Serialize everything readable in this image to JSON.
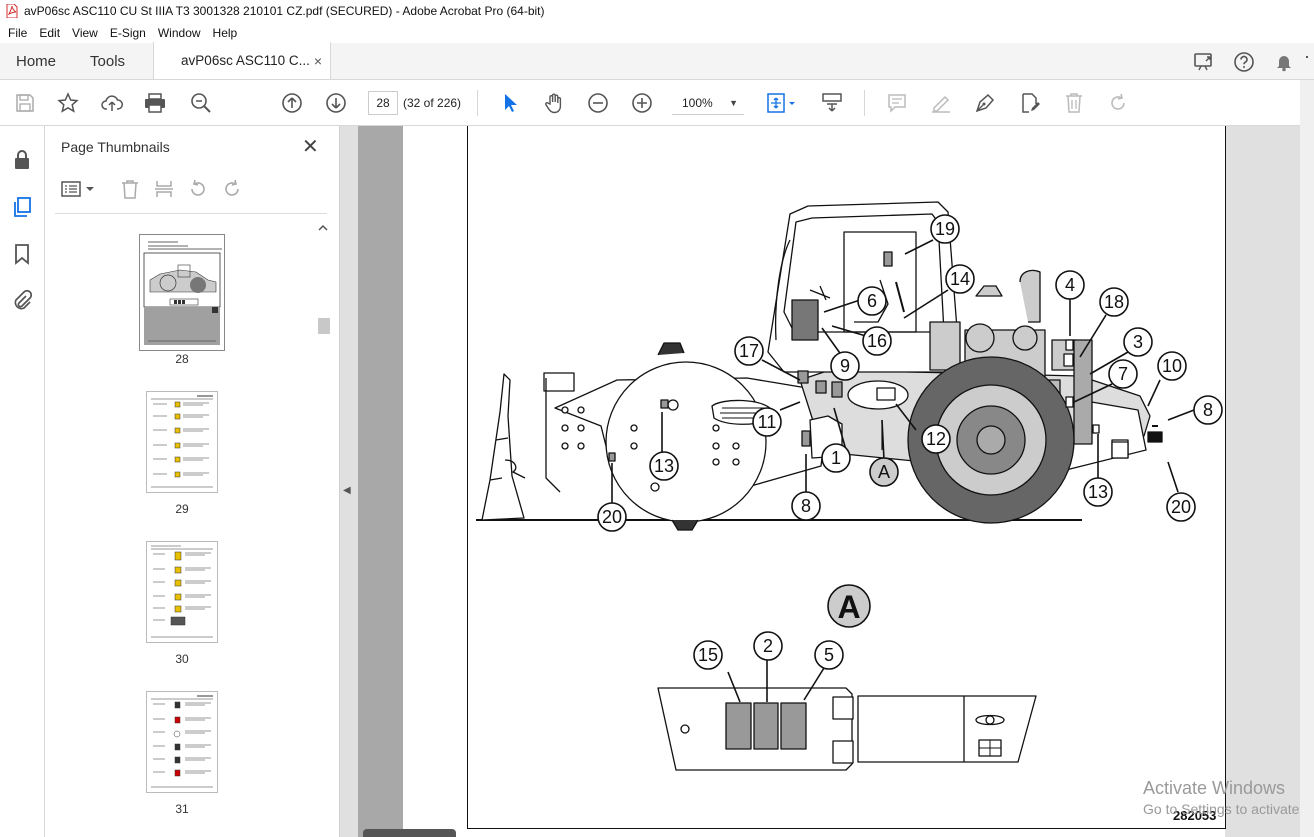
{
  "window": {
    "title": "avP06sc ASC110 CU St IIIA T3 3001328 210101 CZ.pdf (SECURED) - Adobe Acrobat Pro (64-bit)"
  },
  "menu": {
    "items": [
      "File",
      "Edit",
      "View",
      "E-Sign",
      "Window",
      "Help"
    ]
  },
  "tabs": {
    "home": "Home",
    "tools": "Tools",
    "document": "avP06sc ASC110 C...",
    "close_glyph": "×"
  },
  "toolbar": {
    "page_number": "28",
    "page_count": "(32 of 226)",
    "zoom": "100%"
  },
  "thumbnails_panel": {
    "title": "Page Thumbnails",
    "pages": [
      {
        "label": "28",
        "selected": true
      },
      {
        "label": "29",
        "selected": false
      },
      {
        "label": "30",
        "selected": false
      },
      {
        "label": "31",
        "selected": false
      }
    ]
  },
  "document": {
    "figure_number": "282053",
    "detail_label": "A",
    "callouts": {
      "c19": "19",
      "c14": "14",
      "c6": "6",
      "c16": "16",
      "c9": "9",
      "c17": "17",
      "c4": "4",
      "c18": "18",
      "c3": "3",
      "c7": "7",
      "c10": "10",
      "c8r": "8",
      "c11": "11",
      "c12": "12",
      "c1": "1",
      "cA": "A",
      "c13l": "13",
      "c13r": "13",
      "c8b": "8",
      "c20l": "20",
      "c20r": "20",
      "c15": "15",
      "c2": "2",
      "c5": "5"
    }
  },
  "watermark": {
    "line1": "Activate Windows",
    "line2": "Go to Settings to activate"
  }
}
